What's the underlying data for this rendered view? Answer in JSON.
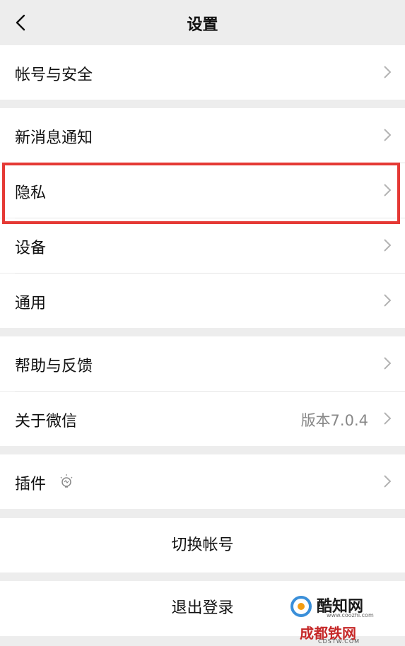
{
  "header": {
    "title": "设置"
  },
  "rows": {
    "account_security": "帐号与安全",
    "new_message": "新消息通知",
    "privacy": "隐私",
    "device": "设备",
    "general": "通用",
    "help_feedback": "帮助与反馈",
    "about": "关于微信",
    "about_version": "版本7.0.4",
    "plugins": "插件"
  },
  "actions": {
    "switch_account": "切换帐号",
    "logout": "退出登录"
  },
  "watermarks": {
    "coozhi_name": "酷知网",
    "coozhi_url": "www.coozhi.com",
    "cdtw_name": "成都铁网",
    "cdtw_url": "CDSTW.COM"
  },
  "colors": {
    "highlight_border": "#e53935",
    "background": "#ededed",
    "row_bg": "#ffffff"
  }
}
